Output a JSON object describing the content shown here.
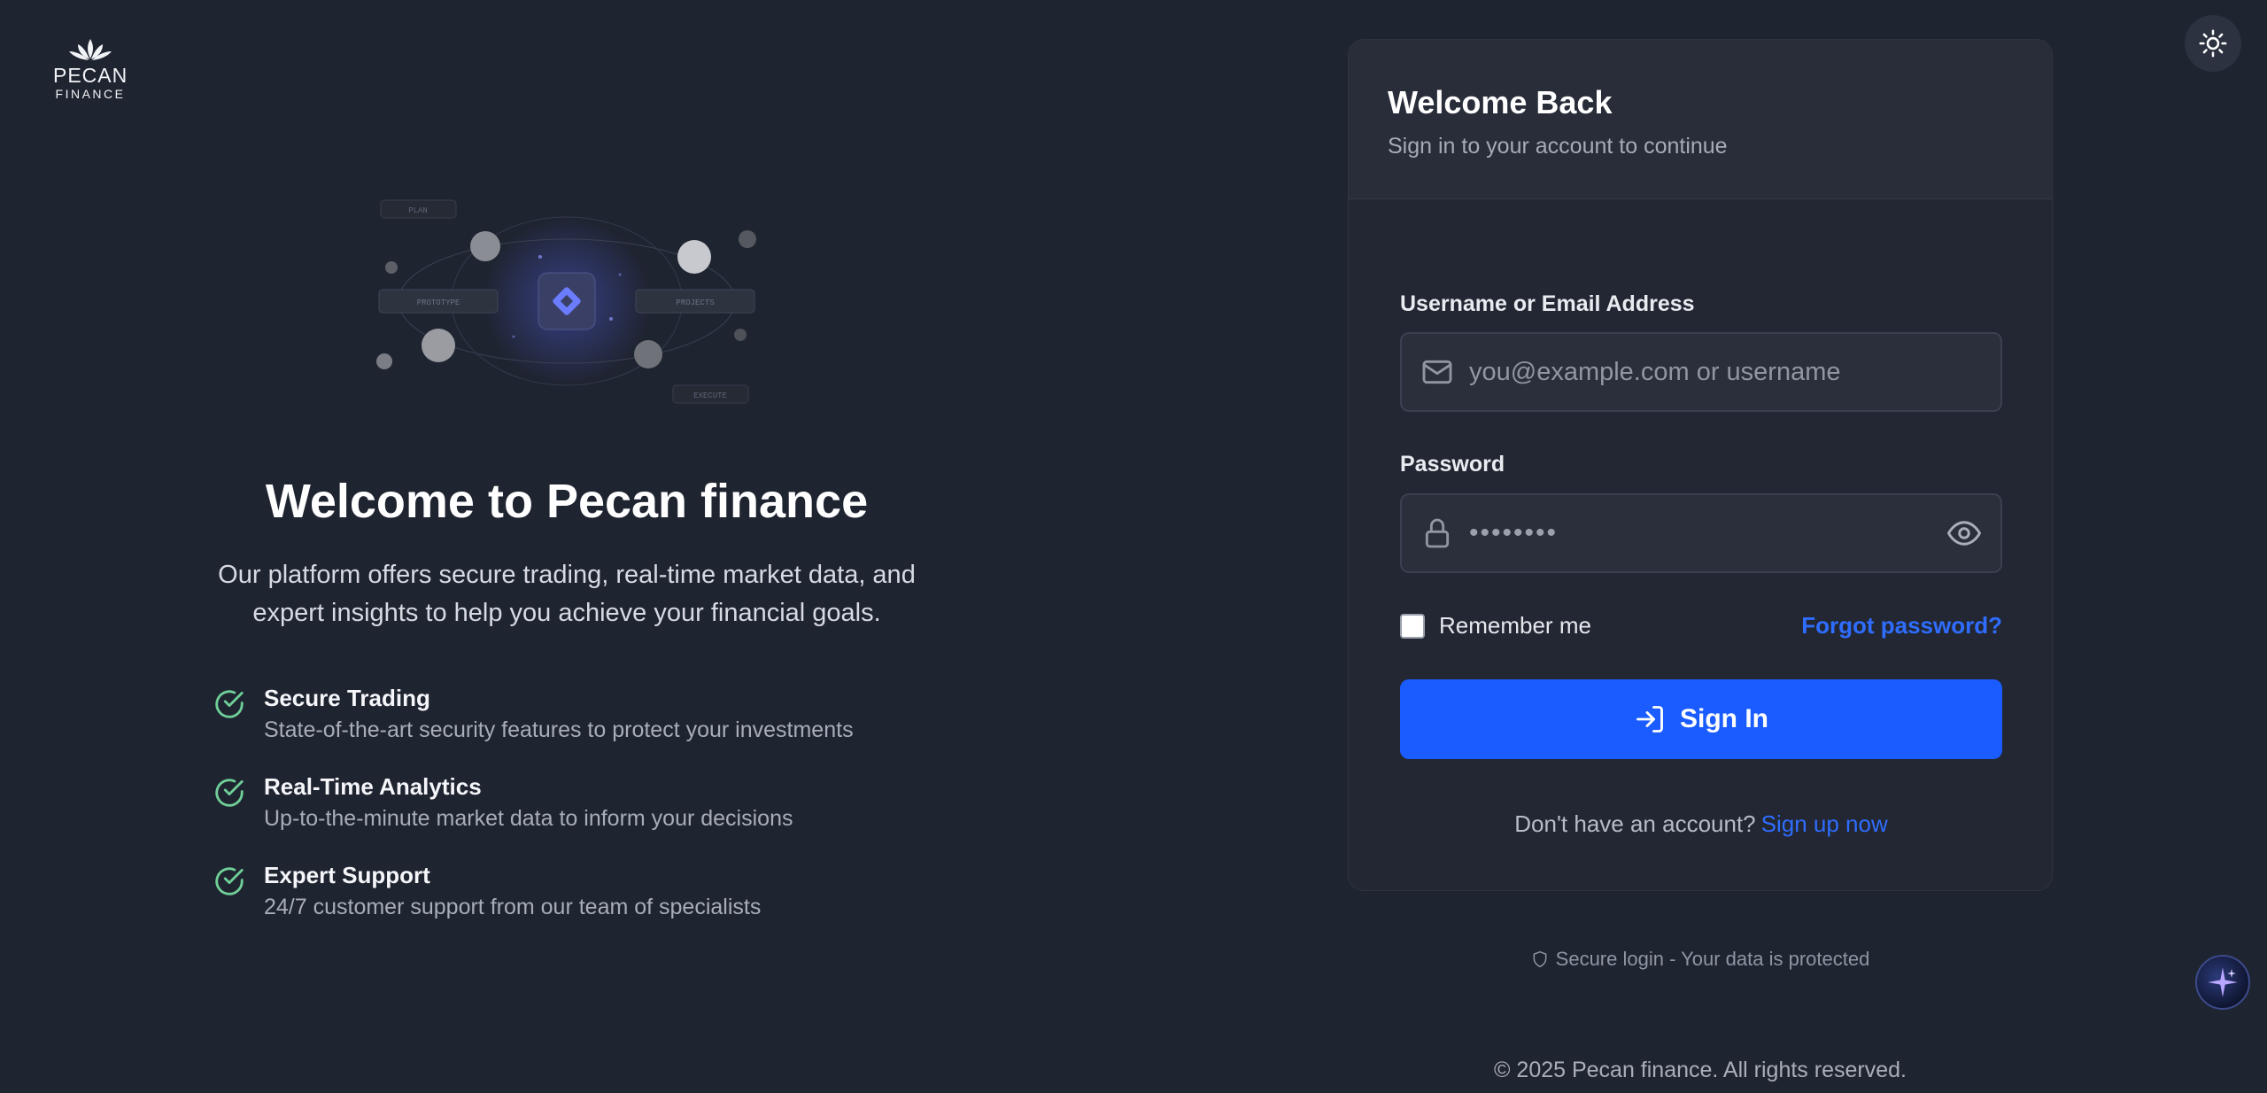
{
  "logo": {
    "name": "PECAN",
    "sub": "FINANCE"
  },
  "illustration": {
    "tags": [
      "PLAN",
      "PROTOTYPE",
      "PROJECTS",
      "EXECUTE"
    ]
  },
  "hero": {
    "title": "Welcome to Pecan finance",
    "description": "Our platform offers secure trading, real-time market data, and expert insights to help you achieve your financial goals."
  },
  "features": [
    {
      "title": "Secure Trading",
      "desc": "State-of-the-art security features to protect your investments"
    },
    {
      "title": "Real-Time Analytics",
      "desc": "Up-to-the-minute market data to inform your decisions"
    },
    {
      "title": "Expert Support",
      "desc": "24/7 customer support from our team of specialists"
    }
  ],
  "card": {
    "title": "Welcome Back",
    "subtitle": "Sign in to your account to continue",
    "username_label": "Username or Email Address",
    "username_placeholder": "you@example.com or username",
    "password_label": "Password",
    "password_value": "••••••••",
    "remember_label": "Remember me",
    "forgot_label": "Forgot password?",
    "signin_label": "Sign In",
    "signup_prompt": "Don't have an account?",
    "signup_link": "Sign up now"
  },
  "secure_note": "Secure login - Your data is protected",
  "copyright": "© 2025 Pecan finance. All rights reserved.",
  "colors": {
    "background": "#1f2431",
    "card": "#222733",
    "accent": "#1a5cff",
    "link": "#2f6dff",
    "check": "#6fcf97"
  },
  "icons": {
    "theme": "sun-icon",
    "username": "mail-icon",
    "password": "lock-icon",
    "visibility": "eye-icon",
    "signin": "login-icon",
    "feature": "check-circle-icon",
    "secure": "shield-icon",
    "assistant": "sparkle-icon"
  }
}
